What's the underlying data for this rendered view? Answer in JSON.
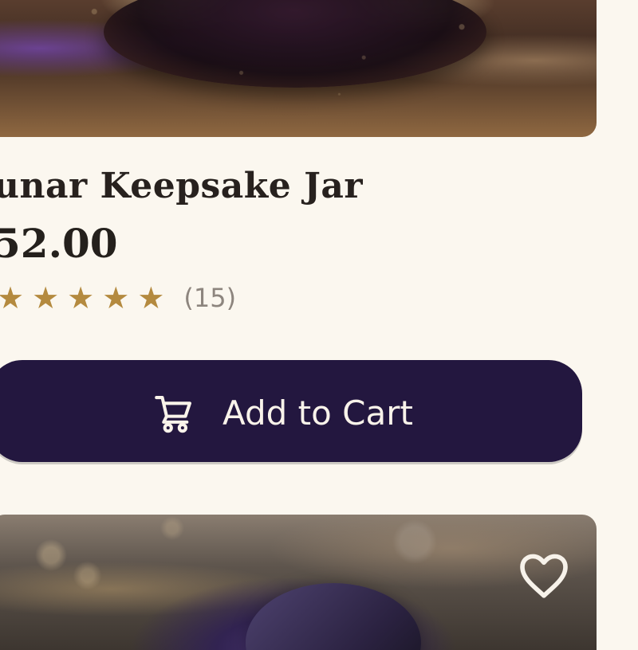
{
  "product": {
    "title": "unar Keepsake Jar",
    "price": "52.00",
    "rating": 5,
    "review_count": "(15)"
  },
  "actions": {
    "add_to_cart_label": "Add to Cart",
    "cart_icon": "shopping-cart-icon",
    "favorite_icon": "heart-outline-icon"
  },
  "colors": {
    "background": "#fbf7ef",
    "button": "#23173f",
    "button_text": "#f9f3ea",
    "star": "#b48a3f",
    "text": "#27211e",
    "muted_text": "#8d857e"
  }
}
